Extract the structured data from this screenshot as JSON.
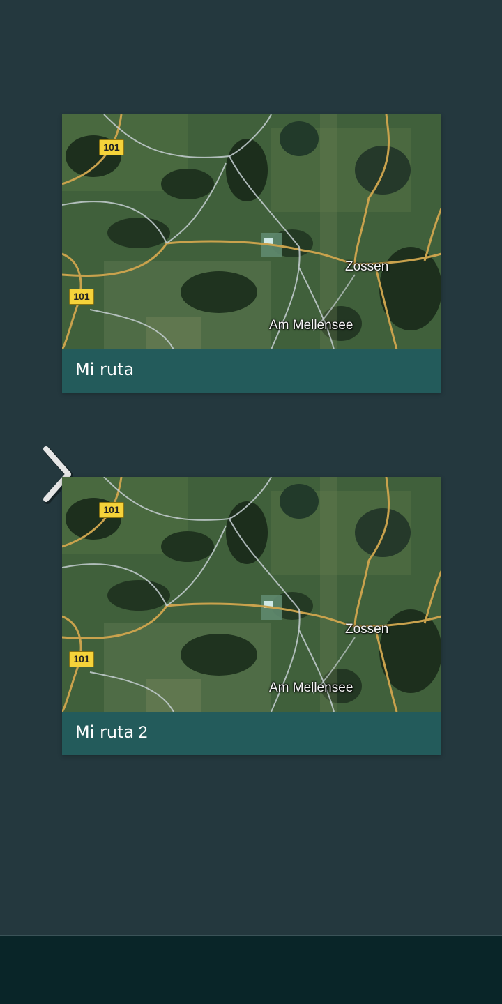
{
  "colors": {
    "background": "#24383e",
    "caption_background": "#235b5b",
    "bottom_bar": "#092528",
    "road_shield": "#f5d33a"
  },
  "routes": [
    {
      "name": "Mi ruta",
      "number": "",
      "map": {
        "towns": [
          "Zossen",
          "Am Mellensee"
        ],
        "road_shields": [
          "101",
          "101"
        ]
      }
    },
    {
      "name": "Mi ruta",
      "number": "2",
      "map": {
        "towns": [
          "Zossen",
          "Am Mellensee"
        ],
        "road_shields": [
          "101",
          "101"
        ]
      }
    }
  ],
  "icons": {
    "next": "chevron-right-icon"
  }
}
